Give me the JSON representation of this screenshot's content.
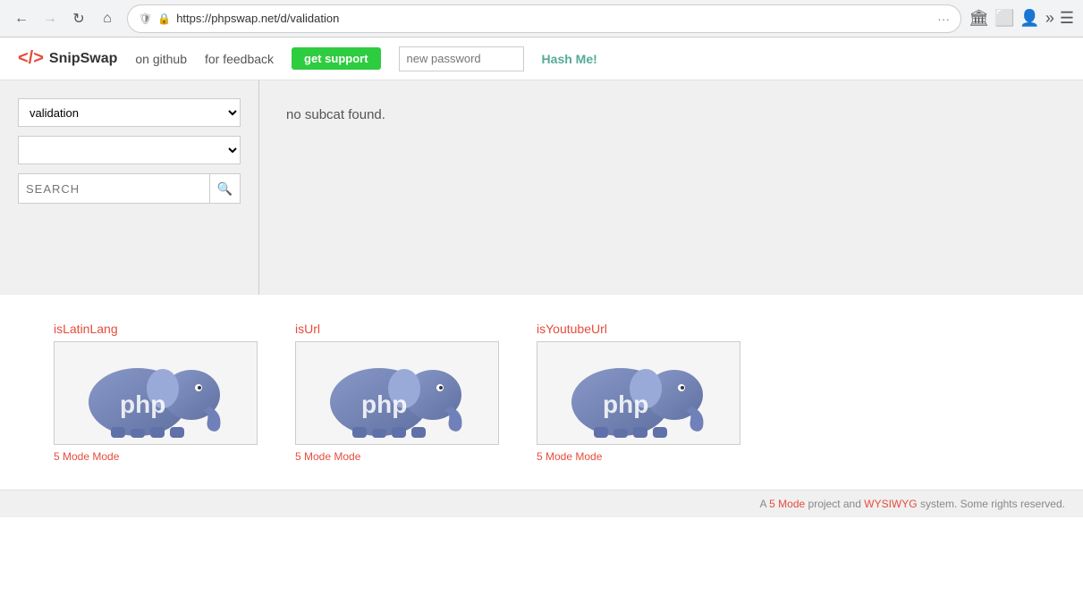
{
  "browser": {
    "url": "https://phpswap.net/d/validation",
    "back_btn": "←",
    "forward_btn": "→",
    "reload_btn": "↺",
    "home_btn": "⌂",
    "more_btn": "···",
    "bookmark_icon": "☆",
    "pocket_icon": "❤",
    "overflow_icon": "»",
    "menu_icon": "≡"
  },
  "header": {
    "logo_icon": "</>",
    "logo_text": "SnipSwap",
    "nav": [
      {
        "label": "on github",
        "href": "#"
      },
      {
        "label": "for feedback",
        "href": "#"
      }
    ],
    "get_support_label": "get support",
    "password_placeholder": "new password",
    "hash_me_label": "Hash Me!"
  },
  "sidebar": {
    "category_value": "validation",
    "category_options": [
      "validation"
    ],
    "subcategory_options": [],
    "search_placeholder": "SEARCH"
  },
  "right_panel": {
    "no_subcat_message": "no subcat found."
  },
  "snippets": [
    {
      "title": "isLatinLang",
      "mode_label": "5 Mode",
      "mode_link": "5 Mode"
    },
    {
      "title": "isUrl",
      "mode_label": "5 Mode",
      "mode_link": "5 Mode"
    },
    {
      "title": "isYoutubeUrl",
      "mode_label": "5 Mode",
      "mode_link": "5 Mode"
    }
  ],
  "footer": {
    "text": "A ",
    "mode_link": "5 Mode",
    "text2": " project and ",
    "wysiwyg_link": "WYSIWYG",
    "text3": " system. Some rights reserved."
  }
}
